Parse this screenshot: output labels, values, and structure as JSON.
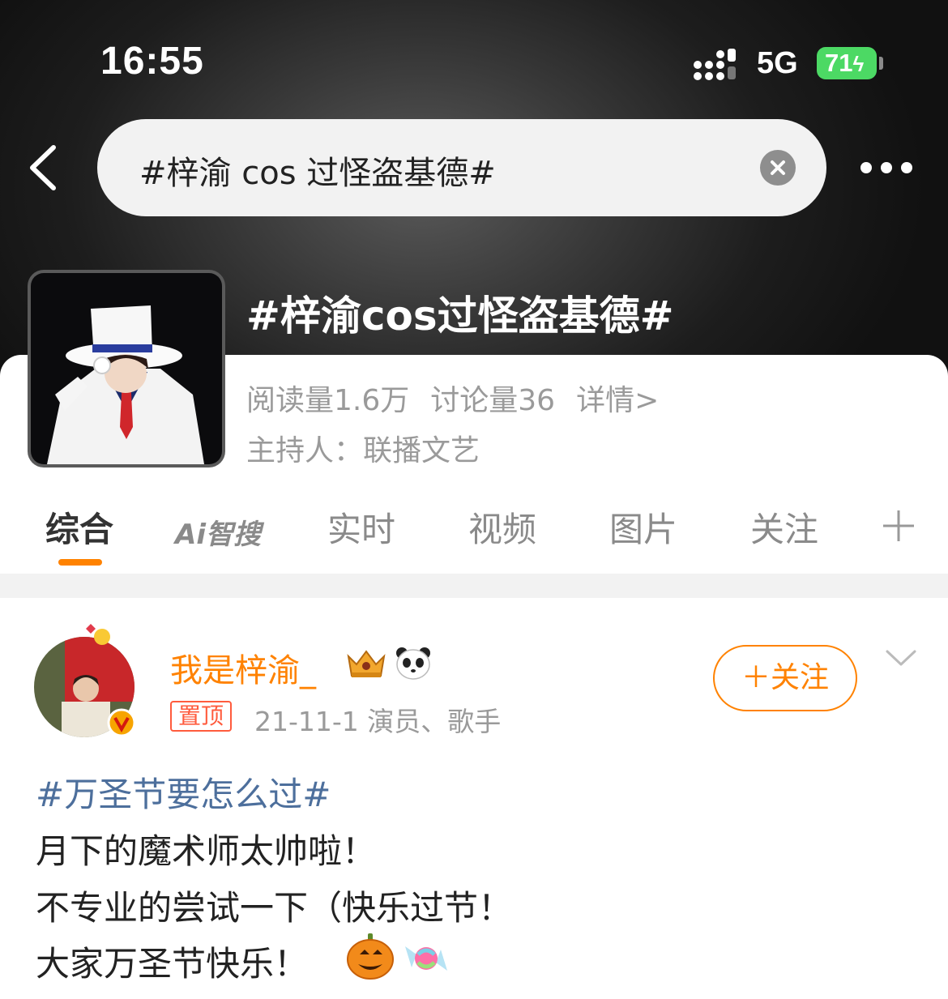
{
  "status_bar": {
    "time": "16:55",
    "network": "5G",
    "battery": "71"
  },
  "search": {
    "query": "#梓渝 cos 过怪盗基德#"
  },
  "topic": {
    "title": "#梓渝cos过怪盗基德#",
    "reads": "阅读量1.6万",
    "discussions": "讨论量36",
    "details": "详情>",
    "host": "主持人：联播文艺"
  },
  "tabs": {
    "items": [
      "综合",
      "Ai智搜",
      "实时",
      "视频",
      "图片",
      "关注"
    ],
    "active": "综合",
    "accent_color": "#ff8200"
  },
  "post": {
    "username": "我是梓渝_",
    "pinned_label": "置顶",
    "meta": "21-11-1  演员、歌手",
    "follow_label": "＋关注",
    "hashtag": "#万圣节要怎么过#",
    "lines": [
      "月下的魔术师太帅啦！",
      "不专业的尝试一下（快乐过节！",
      "大家万圣节快乐！"
    ],
    "username_color": "#ff8200",
    "hashtag_color": "#4d6f9c"
  },
  "icons": [
    "back-arrow-icon",
    "clear-icon",
    "more-icon",
    "signal-icon",
    "plus-icon",
    "chevron-down-icon",
    "verified-v-icon",
    "crown-icon",
    "panda-icon",
    "pumpkin-icon",
    "candy-icon"
  ]
}
